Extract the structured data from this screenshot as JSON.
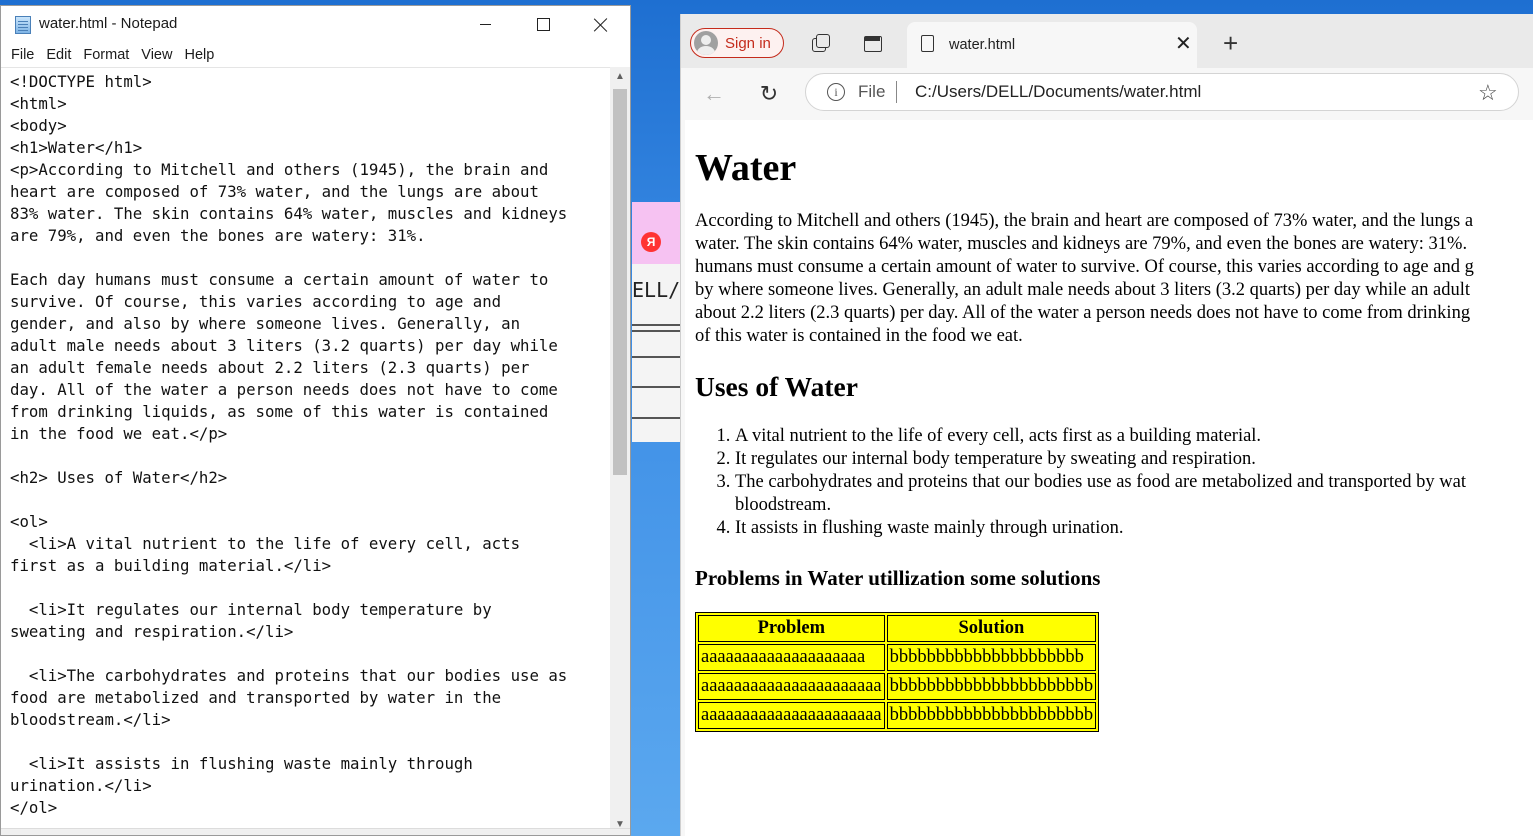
{
  "notepad": {
    "title": "water.html - Notepad",
    "menu": [
      "File",
      "Edit",
      "Format",
      "View",
      "Help"
    ],
    "content": "<!DOCTYPE html>\n<html>\n<body>\n<h1>Water</h1>\n<p>According to Mitchell and others (1945), the brain and\nheart are composed of 73% water, and the lungs are about\n83% water. The skin contains 64% water, muscles and kidneys\nare 79%, and even the bones are watery: 31%.\n\nEach day humans must consume a certain amount of water to\nsurvive. Of course, this varies according to age and\ngender, and also by where someone lives. Generally, an\nadult male needs about 3 liters (3.2 quarts) per day while\nan adult female needs about 2.2 liters (2.3 quarts) per\nday. All of the water a person needs does not have to come\nfrom drinking liquids, as some of this water is contained\nin the food we eat.</p>\n\n<h2> Uses of Water</h2>\n\n<ol>\n  <li>A vital nutrient to the life of every cell, acts\nfirst as a building material.</li>\n\n  <li>It regulates our internal body temperature by\nsweating and respiration.</li>\n\n  <li>The carbohydrates and proteins that our bodies use as\nfood are metabolized and transported by water in the\nbloodstream.</li>\n\n  <li>It assists in flushing waste mainly through\nurination.</li>\n</ol>"
  },
  "background_window": {
    "fragment": "ELL/D",
    "badge": "Я"
  },
  "browser": {
    "sign_in_label": "Sign in",
    "tab_title": "water.html",
    "address_scheme": "File",
    "address_path": "C:/Users/DELL/Documents/water.html",
    "accent_color": "#c42b1c"
  },
  "page": {
    "h1": "Water",
    "paragraph_lines": [
      "According to Mitchell and others (1945), the brain and heart are composed of 73% water, and the lungs a",
      "water. The skin contains 64% water, muscles and kidneys are 79%, and even the bones are watery: 31%.",
      "humans must consume a certain amount of water to survive. Of course, this varies according to age and g",
      "by where someone lives. Generally, an adult male needs about 3 liters (3.2 quarts) per day while an adult",
      "about 2.2 liters (2.3 quarts) per day. All of the water a person needs does not have to come from drinking",
      "of this water is contained in the food we eat."
    ],
    "h2": "Uses of Water",
    "list": [
      "A vital nutrient to the life of every cell, acts first as a building material.",
      "It regulates our internal body temperature by sweating and respiration.",
      "The carbohydrates and proteins that our bodies use as food are metabolized and transported by wat",
      "It assists in flushing waste mainly through urination."
    ],
    "list_item3_cont": "bloodstream.",
    "h3": "Problems in Water utillization some solutions",
    "table": {
      "headers": [
        "Problem",
        "Solution"
      ],
      "rows": [
        [
          "aaaaaaaaaaaaaaaaaaaa",
          "bbbbbbbbbbbbbbbbbbbbb"
        ],
        [
          "aaaaaaaaaaaaaaaaaaaaaa",
          "bbbbbbbbbbbbbbbbbbbbbb"
        ],
        [
          "aaaaaaaaaaaaaaaaaaaaaa",
          "bbbbbbbbbbbbbbbbbbbbbb"
        ]
      ],
      "background": "#ffff00"
    }
  }
}
